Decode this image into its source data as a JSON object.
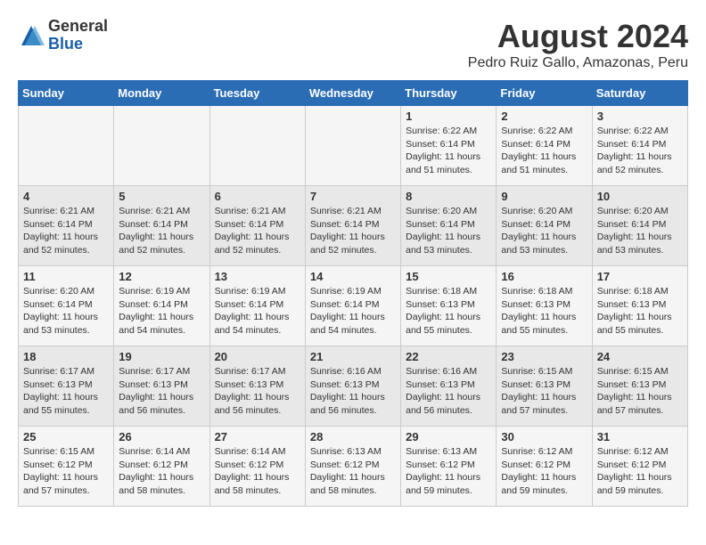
{
  "logo": {
    "general": "General",
    "blue": "Blue"
  },
  "title": "August 2024",
  "subtitle": "Pedro Ruiz Gallo, Amazonas, Peru",
  "days_of_week": [
    "Sunday",
    "Monday",
    "Tuesday",
    "Wednesday",
    "Thursday",
    "Friday",
    "Saturday"
  ],
  "weeks": [
    [
      {
        "day": "",
        "info": ""
      },
      {
        "day": "",
        "info": ""
      },
      {
        "day": "",
        "info": ""
      },
      {
        "day": "",
        "info": ""
      },
      {
        "day": "1",
        "info": "Sunrise: 6:22 AM\nSunset: 6:14 PM\nDaylight: 11 hours and 51 minutes."
      },
      {
        "day": "2",
        "info": "Sunrise: 6:22 AM\nSunset: 6:14 PM\nDaylight: 11 hours and 51 minutes."
      },
      {
        "day": "3",
        "info": "Sunrise: 6:22 AM\nSunset: 6:14 PM\nDaylight: 11 hours and 52 minutes."
      }
    ],
    [
      {
        "day": "4",
        "info": "Sunrise: 6:21 AM\nSunset: 6:14 PM\nDaylight: 11 hours and 52 minutes."
      },
      {
        "day": "5",
        "info": "Sunrise: 6:21 AM\nSunset: 6:14 PM\nDaylight: 11 hours and 52 minutes."
      },
      {
        "day": "6",
        "info": "Sunrise: 6:21 AM\nSunset: 6:14 PM\nDaylight: 11 hours and 52 minutes."
      },
      {
        "day": "7",
        "info": "Sunrise: 6:21 AM\nSunset: 6:14 PM\nDaylight: 11 hours and 52 minutes."
      },
      {
        "day": "8",
        "info": "Sunrise: 6:20 AM\nSunset: 6:14 PM\nDaylight: 11 hours and 53 minutes."
      },
      {
        "day": "9",
        "info": "Sunrise: 6:20 AM\nSunset: 6:14 PM\nDaylight: 11 hours and 53 minutes."
      },
      {
        "day": "10",
        "info": "Sunrise: 6:20 AM\nSunset: 6:14 PM\nDaylight: 11 hours and 53 minutes."
      }
    ],
    [
      {
        "day": "11",
        "info": "Sunrise: 6:20 AM\nSunset: 6:14 PM\nDaylight: 11 hours and 53 minutes."
      },
      {
        "day": "12",
        "info": "Sunrise: 6:19 AM\nSunset: 6:14 PM\nDaylight: 11 hours and 54 minutes."
      },
      {
        "day": "13",
        "info": "Sunrise: 6:19 AM\nSunset: 6:14 PM\nDaylight: 11 hours and 54 minutes."
      },
      {
        "day": "14",
        "info": "Sunrise: 6:19 AM\nSunset: 6:14 PM\nDaylight: 11 hours and 54 minutes."
      },
      {
        "day": "15",
        "info": "Sunrise: 6:18 AM\nSunset: 6:13 PM\nDaylight: 11 hours and 55 minutes."
      },
      {
        "day": "16",
        "info": "Sunrise: 6:18 AM\nSunset: 6:13 PM\nDaylight: 11 hours and 55 minutes."
      },
      {
        "day": "17",
        "info": "Sunrise: 6:18 AM\nSunset: 6:13 PM\nDaylight: 11 hours and 55 minutes."
      }
    ],
    [
      {
        "day": "18",
        "info": "Sunrise: 6:17 AM\nSunset: 6:13 PM\nDaylight: 11 hours and 55 minutes."
      },
      {
        "day": "19",
        "info": "Sunrise: 6:17 AM\nSunset: 6:13 PM\nDaylight: 11 hours and 56 minutes."
      },
      {
        "day": "20",
        "info": "Sunrise: 6:17 AM\nSunset: 6:13 PM\nDaylight: 11 hours and 56 minutes."
      },
      {
        "day": "21",
        "info": "Sunrise: 6:16 AM\nSunset: 6:13 PM\nDaylight: 11 hours and 56 minutes."
      },
      {
        "day": "22",
        "info": "Sunrise: 6:16 AM\nSunset: 6:13 PM\nDaylight: 11 hours and 56 minutes."
      },
      {
        "day": "23",
        "info": "Sunrise: 6:15 AM\nSunset: 6:13 PM\nDaylight: 11 hours and 57 minutes."
      },
      {
        "day": "24",
        "info": "Sunrise: 6:15 AM\nSunset: 6:13 PM\nDaylight: 11 hours and 57 minutes."
      }
    ],
    [
      {
        "day": "25",
        "info": "Sunrise: 6:15 AM\nSunset: 6:12 PM\nDaylight: 11 hours and 57 minutes."
      },
      {
        "day": "26",
        "info": "Sunrise: 6:14 AM\nSunset: 6:12 PM\nDaylight: 11 hours and 58 minutes."
      },
      {
        "day": "27",
        "info": "Sunrise: 6:14 AM\nSunset: 6:12 PM\nDaylight: 11 hours and 58 minutes."
      },
      {
        "day": "28",
        "info": "Sunrise: 6:13 AM\nSunset: 6:12 PM\nDaylight: 11 hours and 58 minutes."
      },
      {
        "day": "29",
        "info": "Sunrise: 6:13 AM\nSunset: 6:12 PM\nDaylight: 11 hours and 59 minutes."
      },
      {
        "day": "30",
        "info": "Sunrise: 6:12 AM\nSunset: 6:12 PM\nDaylight: 11 hours and 59 minutes."
      },
      {
        "day": "31",
        "info": "Sunrise: 6:12 AM\nSunset: 6:12 PM\nDaylight: 11 hours and 59 minutes."
      }
    ]
  ]
}
